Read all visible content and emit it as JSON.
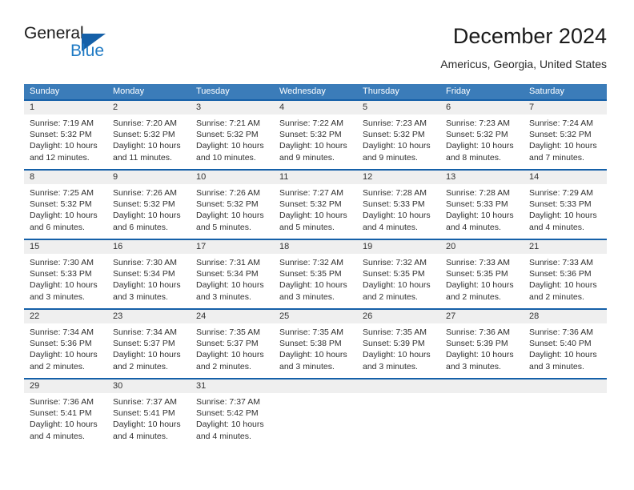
{
  "logo": {
    "word_one": "General",
    "word_two": "Blue",
    "flag_icon": "blue-triangle-flag-icon",
    "accent_color": "#1560a8",
    "blue_text_color": "#1f7ac4"
  },
  "header": {
    "title": "December 2024",
    "subtitle": "Americus, Georgia, United States"
  },
  "theme": {
    "header_band": "#3b7cb9",
    "row_divider": "#1560a8",
    "day_band": "#efefef",
    "text": "#303030"
  },
  "weekdays": [
    "Sunday",
    "Monday",
    "Tuesday",
    "Wednesday",
    "Thursday",
    "Friday",
    "Saturday"
  ],
  "weeks": [
    [
      {
        "day": "1",
        "sunrise": "Sunrise: 7:19 AM",
        "sunset": "Sunset: 5:32 PM",
        "daylight_1": "Daylight: 10 hours",
        "daylight_2": "and 12 minutes."
      },
      {
        "day": "2",
        "sunrise": "Sunrise: 7:20 AM",
        "sunset": "Sunset: 5:32 PM",
        "daylight_1": "Daylight: 10 hours",
        "daylight_2": "and 11 minutes."
      },
      {
        "day": "3",
        "sunrise": "Sunrise: 7:21 AM",
        "sunset": "Sunset: 5:32 PM",
        "daylight_1": "Daylight: 10 hours",
        "daylight_2": "and 10 minutes."
      },
      {
        "day": "4",
        "sunrise": "Sunrise: 7:22 AM",
        "sunset": "Sunset: 5:32 PM",
        "daylight_1": "Daylight: 10 hours",
        "daylight_2": "and 9 minutes."
      },
      {
        "day": "5",
        "sunrise": "Sunrise: 7:23 AM",
        "sunset": "Sunset: 5:32 PM",
        "daylight_1": "Daylight: 10 hours",
        "daylight_2": "and 9 minutes."
      },
      {
        "day": "6",
        "sunrise": "Sunrise: 7:23 AM",
        "sunset": "Sunset: 5:32 PM",
        "daylight_1": "Daylight: 10 hours",
        "daylight_2": "and 8 minutes."
      },
      {
        "day": "7",
        "sunrise": "Sunrise: 7:24 AM",
        "sunset": "Sunset: 5:32 PM",
        "daylight_1": "Daylight: 10 hours",
        "daylight_2": "and 7 minutes."
      }
    ],
    [
      {
        "day": "8",
        "sunrise": "Sunrise: 7:25 AM",
        "sunset": "Sunset: 5:32 PM",
        "daylight_1": "Daylight: 10 hours",
        "daylight_2": "and 6 minutes."
      },
      {
        "day": "9",
        "sunrise": "Sunrise: 7:26 AM",
        "sunset": "Sunset: 5:32 PM",
        "daylight_1": "Daylight: 10 hours",
        "daylight_2": "and 6 minutes."
      },
      {
        "day": "10",
        "sunrise": "Sunrise: 7:26 AM",
        "sunset": "Sunset: 5:32 PM",
        "daylight_1": "Daylight: 10 hours",
        "daylight_2": "and 5 minutes."
      },
      {
        "day": "11",
        "sunrise": "Sunrise: 7:27 AM",
        "sunset": "Sunset: 5:32 PM",
        "daylight_1": "Daylight: 10 hours",
        "daylight_2": "and 5 minutes."
      },
      {
        "day": "12",
        "sunrise": "Sunrise: 7:28 AM",
        "sunset": "Sunset: 5:33 PM",
        "daylight_1": "Daylight: 10 hours",
        "daylight_2": "and 4 minutes."
      },
      {
        "day": "13",
        "sunrise": "Sunrise: 7:28 AM",
        "sunset": "Sunset: 5:33 PM",
        "daylight_1": "Daylight: 10 hours",
        "daylight_2": "and 4 minutes."
      },
      {
        "day": "14",
        "sunrise": "Sunrise: 7:29 AM",
        "sunset": "Sunset: 5:33 PM",
        "daylight_1": "Daylight: 10 hours",
        "daylight_2": "and 4 minutes."
      }
    ],
    [
      {
        "day": "15",
        "sunrise": "Sunrise: 7:30 AM",
        "sunset": "Sunset: 5:33 PM",
        "daylight_1": "Daylight: 10 hours",
        "daylight_2": "and 3 minutes."
      },
      {
        "day": "16",
        "sunrise": "Sunrise: 7:30 AM",
        "sunset": "Sunset: 5:34 PM",
        "daylight_1": "Daylight: 10 hours",
        "daylight_2": "and 3 minutes."
      },
      {
        "day": "17",
        "sunrise": "Sunrise: 7:31 AM",
        "sunset": "Sunset: 5:34 PM",
        "daylight_1": "Daylight: 10 hours",
        "daylight_2": "and 3 minutes."
      },
      {
        "day": "18",
        "sunrise": "Sunrise: 7:32 AM",
        "sunset": "Sunset: 5:35 PM",
        "daylight_1": "Daylight: 10 hours",
        "daylight_2": "and 3 minutes."
      },
      {
        "day": "19",
        "sunrise": "Sunrise: 7:32 AM",
        "sunset": "Sunset: 5:35 PM",
        "daylight_1": "Daylight: 10 hours",
        "daylight_2": "and 2 minutes."
      },
      {
        "day": "20",
        "sunrise": "Sunrise: 7:33 AM",
        "sunset": "Sunset: 5:35 PM",
        "daylight_1": "Daylight: 10 hours",
        "daylight_2": "and 2 minutes."
      },
      {
        "day": "21",
        "sunrise": "Sunrise: 7:33 AM",
        "sunset": "Sunset: 5:36 PM",
        "daylight_1": "Daylight: 10 hours",
        "daylight_2": "and 2 minutes."
      }
    ],
    [
      {
        "day": "22",
        "sunrise": "Sunrise: 7:34 AM",
        "sunset": "Sunset: 5:36 PM",
        "daylight_1": "Daylight: 10 hours",
        "daylight_2": "and 2 minutes."
      },
      {
        "day": "23",
        "sunrise": "Sunrise: 7:34 AM",
        "sunset": "Sunset: 5:37 PM",
        "daylight_1": "Daylight: 10 hours",
        "daylight_2": "and 2 minutes."
      },
      {
        "day": "24",
        "sunrise": "Sunrise: 7:35 AM",
        "sunset": "Sunset: 5:37 PM",
        "daylight_1": "Daylight: 10 hours",
        "daylight_2": "and 2 minutes."
      },
      {
        "day": "25",
        "sunrise": "Sunrise: 7:35 AM",
        "sunset": "Sunset: 5:38 PM",
        "daylight_1": "Daylight: 10 hours",
        "daylight_2": "and 3 minutes."
      },
      {
        "day": "26",
        "sunrise": "Sunrise: 7:35 AM",
        "sunset": "Sunset: 5:39 PM",
        "daylight_1": "Daylight: 10 hours",
        "daylight_2": "and 3 minutes."
      },
      {
        "day": "27",
        "sunrise": "Sunrise: 7:36 AM",
        "sunset": "Sunset: 5:39 PM",
        "daylight_1": "Daylight: 10 hours",
        "daylight_2": "and 3 minutes."
      },
      {
        "day": "28",
        "sunrise": "Sunrise: 7:36 AM",
        "sunset": "Sunset: 5:40 PM",
        "daylight_1": "Daylight: 10 hours",
        "daylight_2": "and 3 minutes."
      }
    ],
    [
      {
        "day": "29",
        "sunrise": "Sunrise: 7:36 AM",
        "sunset": "Sunset: 5:41 PM",
        "daylight_1": "Daylight: 10 hours",
        "daylight_2": "and 4 minutes."
      },
      {
        "day": "30",
        "sunrise": "Sunrise: 7:37 AM",
        "sunset": "Sunset: 5:41 PM",
        "daylight_1": "Daylight: 10 hours",
        "daylight_2": "and 4 minutes."
      },
      {
        "day": "31",
        "sunrise": "Sunrise: 7:37 AM",
        "sunset": "Sunset: 5:42 PM",
        "daylight_1": "Daylight: 10 hours",
        "daylight_2": "and 4 minutes."
      },
      {
        "day": "",
        "sunrise": "",
        "sunset": "",
        "daylight_1": "",
        "daylight_2": ""
      },
      {
        "day": "",
        "sunrise": "",
        "sunset": "",
        "daylight_1": "",
        "daylight_2": ""
      },
      {
        "day": "",
        "sunrise": "",
        "sunset": "",
        "daylight_1": "",
        "daylight_2": ""
      },
      {
        "day": "",
        "sunrise": "",
        "sunset": "",
        "daylight_1": "",
        "daylight_2": ""
      }
    ]
  ]
}
